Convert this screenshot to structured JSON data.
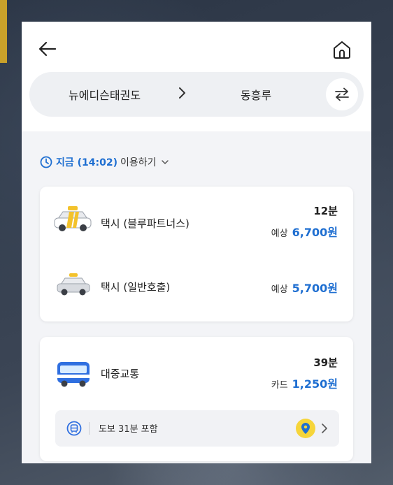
{
  "route": {
    "from": "뉴에디슨태권도",
    "to": "동흥루"
  },
  "departure": {
    "time_label": "지금 (14:02)",
    "suffix": "이용하기"
  },
  "taxi_options": [
    {
      "label": "택시 (블루파트너스)",
      "time": "12분",
      "fare_prefix": "예상",
      "fare": "6,700원",
      "icon": "blue-taxi-icon"
    },
    {
      "label": "택시 (일반호출)",
      "time": "",
      "fare_prefix": "예상",
      "fare": "5,700원",
      "icon": "taxi-icon"
    }
  ],
  "transit": {
    "label": "대중교통",
    "time": "39분",
    "fare_prefix": "카드",
    "fare": "1,250원",
    "walk_text": "도보 31분 포함",
    "icon": "bus-icon"
  },
  "colors": {
    "accent": "#1f6fd1",
    "pin": "#f6d53a",
    "taxi_yellow": "#f3c22b"
  }
}
